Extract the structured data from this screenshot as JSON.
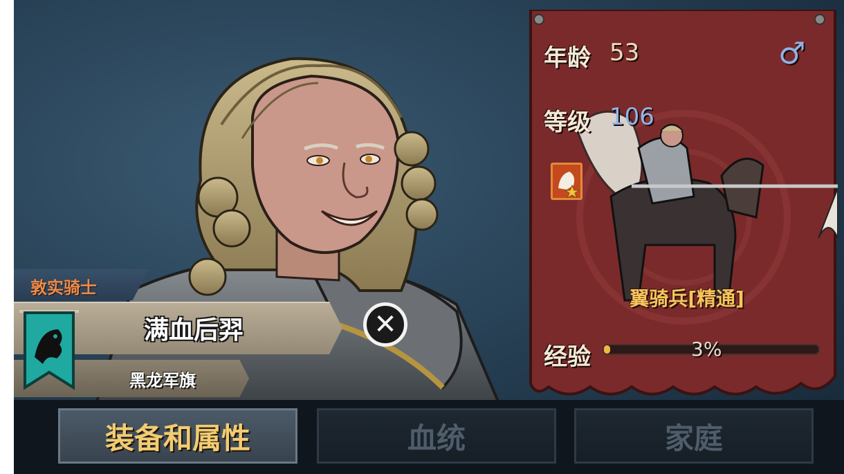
{
  "character": {
    "trait": "敦实骑士",
    "name": "满血后羿",
    "banner": "黑龙军旗"
  },
  "stats": {
    "age_label": "年龄",
    "age_value": "53",
    "gender_symbol": "♂",
    "level_label": "等级",
    "level_value": "106",
    "unit_name": "翼骑兵[精通]",
    "exp_label": "经验",
    "exp_value": "3%",
    "exp_fraction": 0.03
  },
  "tabs": [
    {
      "label": "装备和属性",
      "active": true
    },
    {
      "label": "血统",
      "active": false
    },
    {
      "label": "家庭",
      "active": false
    }
  ],
  "colors": {
    "banner_red": "#7a2a2a",
    "tab_active_text": "#f3cc72",
    "level_blue": "#8fb6ea",
    "exp_fill": "#f0b744"
  }
}
